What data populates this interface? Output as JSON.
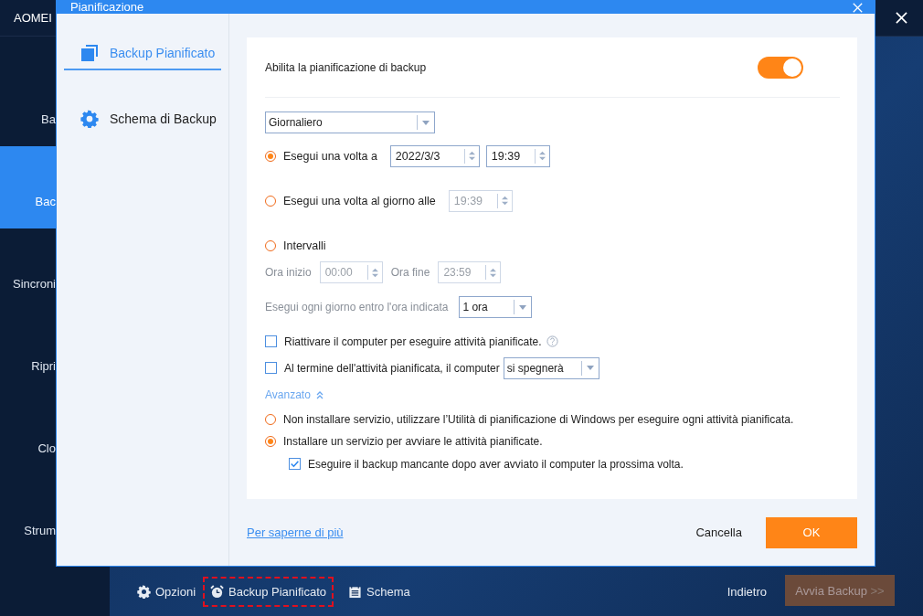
{
  "app": {
    "title": "AOMEI",
    "sidebar": [
      {
        "label": "Ba",
        "selected": false
      },
      {
        "label": "Bac",
        "selected": true
      },
      {
        "label": "Sincroni",
        "selected": false
      },
      {
        "label": "Ripri",
        "selected": false
      },
      {
        "label": "Clo",
        "selected": false
      },
      {
        "label": "Strum",
        "selected": false
      }
    ],
    "bottom_bar": {
      "options": "Opzioni",
      "scheduled": "Backup Pianificato",
      "scheme": "Schema",
      "back": "Indietro",
      "start": "Avvia Backup",
      "start_arrow": ">>"
    }
  },
  "dialog": {
    "title": "Pianificazione",
    "nav": [
      {
        "label": "Backup Pianificato",
        "selected": true,
        "kind": "copy"
      },
      {
        "label": "Schema di Backup",
        "selected": false,
        "kind": "gear"
      }
    ],
    "enable": {
      "label": "Abilita la pianificazione di backup",
      "on": true
    },
    "frequency": "Giornaliero",
    "modes": [
      {
        "label": "Esegui una volta a",
        "selected": true,
        "fields": [
          {
            "value": "2022/3/3",
            "disabled": false
          },
          {
            "value": "19:39",
            "disabled": false
          }
        ]
      },
      {
        "label": "Esegui una volta al giorno alle",
        "selected": false,
        "fields": [
          {
            "value": "19:39",
            "disabled": true
          }
        ]
      },
      {
        "label": "Intervalli",
        "selected": false
      }
    ],
    "interval": {
      "disabled": true,
      "start_label": "Ora inizio",
      "start": "00:00",
      "end_label": "Ora fine",
      "end": "23:59",
      "within_label": "Esegui ogni giorno entro l'ora indicata",
      "within": "1 ora"
    },
    "wake": {
      "label": "Riattivare il computer per eseguire attività pianificate.",
      "checked": false
    },
    "after": {
      "label": "Al termine dell'attività pianificata, il computer",
      "checked": false,
      "action": "si spegnerà"
    },
    "advanced": {
      "label": "Avanzato",
      "expanded": true
    },
    "service": [
      {
        "label": "Non installare servizio, utilizzare l’Utilità di pianificazione di Windows per eseguire ogni attività pianificata.",
        "selected": false
      },
      {
        "label": "Installare un servizio per avviare le attività pianificate.",
        "selected": true
      }
    ],
    "missed": {
      "label": "Eseguire il backup mancante dopo aver avviato il computer la prossima volta.",
      "checked": true
    },
    "learn_more": "Per saperne di più",
    "cancel": "Cancella",
    "ok": "OK"
  }
}
